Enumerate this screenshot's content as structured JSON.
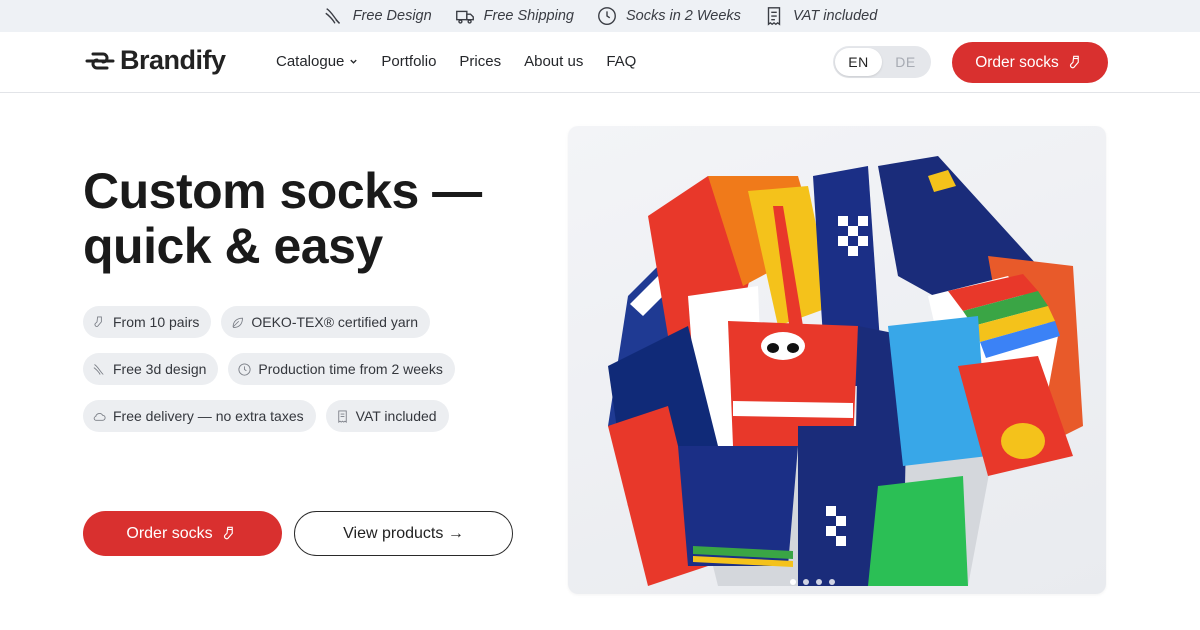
{
  "topbar": {
    "perks": [
      {
        "label": "Free Design",
        "icon": "needle-icon"
      },
      {
        "label": "Free Shipping",
        "icon": "truck-icon"
      },
      {
        "label": "Socks in 2 Weeks",
        "icon": "clock-icon"
      },
      {
        "label": "VAT included",
        "icon": "receipt-icon"
      }
    ]
  },
  "header": {
    "logo_text": "Brandify",
    "nav": [
      {
        "label": "Catalogue",
        "has_dropdown": true
      },
      {
        "label": "Portfolio"
      },
      {
        "label": "Prices"
      },
      {
        "label": "About us"
      },
      {
        "label": "FAQ"
      }
    ],
    "languages": [
      "EN",
      "DE"
    ],
    "active_language": "EN",
    "cta_label": "Order socks"
  },
  "hero": {
    "title_line1": "Custom socks —",
    "title_line2": "quick & easy",
    "features": [
      [
        "From 10 pairs",
        "OEKO-TEX® certified yarn"
      ],
      [
        "Free 3d design",
        "Production time from 2 weeks"
      ],
      [
        "Free delivery — no extra taxes",
        "VAT included"
      ]
    ],
    "primary_button": "Order socks",
    "secondary_button": "View products →",
    "image_alt": "bucket of custom branded socks",
    "carousel": {
      "count": 4,
      "active": 0
    }
  },
  "colors": {
    "accent": "#d9302f",
    "topbar_bg": "#eef1f5",
    "chip_bg": "#eceef1",
    "text": "#1a1a1a"
  }
}
